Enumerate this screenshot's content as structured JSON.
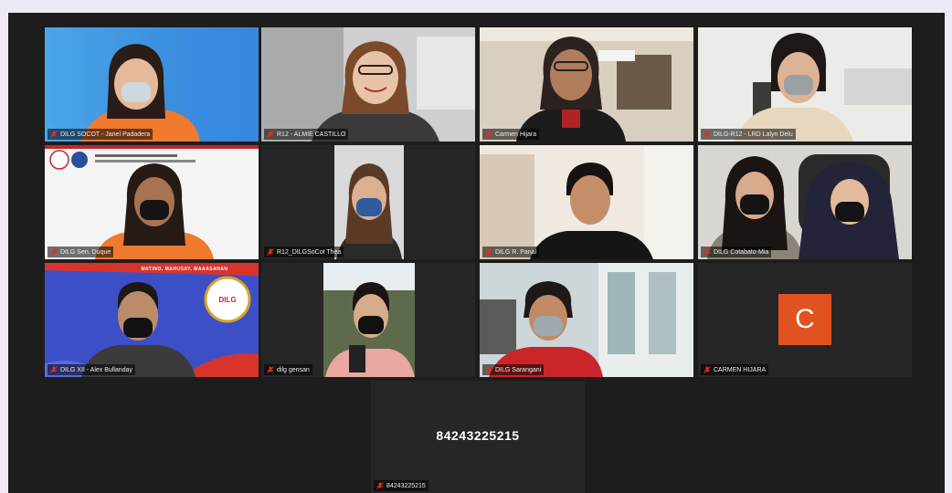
{
  "meeting": {
    "participants": [
      {
        "name": "DILG SOCOT - Janel Padadera",
        "muted": true
      },
      {
        "name": "R12 - ALMIE CASTILLO",
        "muted": true,
        "active": true
      },
      {
        "name": "Carmen Hijara",
        "muted": true
      },
      {
        "name": "DILG-R12 - LRD Lalyn Delu",
        "muted": true
      },
      {
        "name": "DILG Sen. Duque",
        "muted": true
      },
      {
        "name": "R12_DILGSoCot Thea",
        "muted": true
      },
      {
        "name": "DILG R. Panal",
        "muted": true
      },
      {
        "name": "DILG Cotabato-Mia",
        "muted": true
      },
      {
        "name": "DILG XII - Alex Bullanday",
        "muted": true
      },
      {
        "name": "dilg gensan",
        "muted": true
      },
      {
        "name": "DILG Sarangani",
        "muted": true
      },
      {
        "name": "CARMEN HIJARA",
        "muted": true,
        "avatar_letter": "C",
        "avatar_color": "#e0521f"
      },
      {
        "name": "84243225215",
        "muted": true,
        "display_number": "84243225215"
      }
    ],
    "banner_text": "MATINO, MAHUSAY, MAAASAHAN",
    "logo_text": "DILG",
    "colors": {
      "background": "#1d1d1d",
      "active_border": "#c9d64a",
      "mute": "#e0311f"
    }
  }
}
